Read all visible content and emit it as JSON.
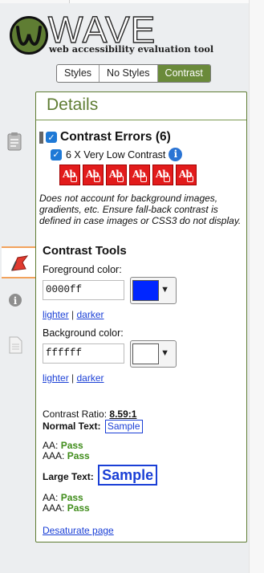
{
  "header": {
    "title": "WAVE",
    "subtitle": "web accessibility evaluation tool"
  },
  "view_buttons": [
    {
      "label": "Styles",
      "active": false
    },
    {
      "label": "No Styles",
      "active": false
    },
    {
      "label": "Contrast",
      "active": true
    }
  ],
  "rail": {
    "icons": [
      "clipboard-icon",
      "flag-icon",
      "info-icon",
      "document-icon"
    ],
    "selected": "flag-icon"
  },
  "details": {
    "title": "Details",
    "category": {
      "title": "Contrast Errors (6)",
      "checked": true,
      "item": {
        "label": "6 X Very Low Contrast",
        "checked": true,
        "count": 6
      }
    },
    "note": "Does not account for background images, gradients, etc. Ensure fall-back contrast is defined in case images or CSS3 do not display."
  },
  "contrast_tools": {
    "title": "Contrast Tools",
    "foreground": {
      "label": "Foreground color:",
      "value": "0000ff",
      "swatch": "#0026ff"
    },
    "background": {
      "label": "Background color:",
      "value": "ffffff",
      "swatch": "#ffffff"
    },
    "lighter": "lighter",
    "separator": "|",
    "darker": "darker",
    "ratio_label": "Contrast Ratio:",
    "ratio_value": "8.59:1",
    "normal_text_label": "Normal Text:",
    "large_text_label": "Large Text:",
    "sample_label": "Sample",
    "aa_label": "AA:",
    "aaa_label": "AAA:",
    "pass_label": "Pass",
    "desaturate": "Desaturate page"
  },
  "colors": {
    "brand_green": "#5f7d33",
    "error_red": "#e21b1b",
    "pass_green": "#3f8c1a",
    "link_blue": "#1a3fd6",
    "selection_orange": "#f2a25c"
  }
}
